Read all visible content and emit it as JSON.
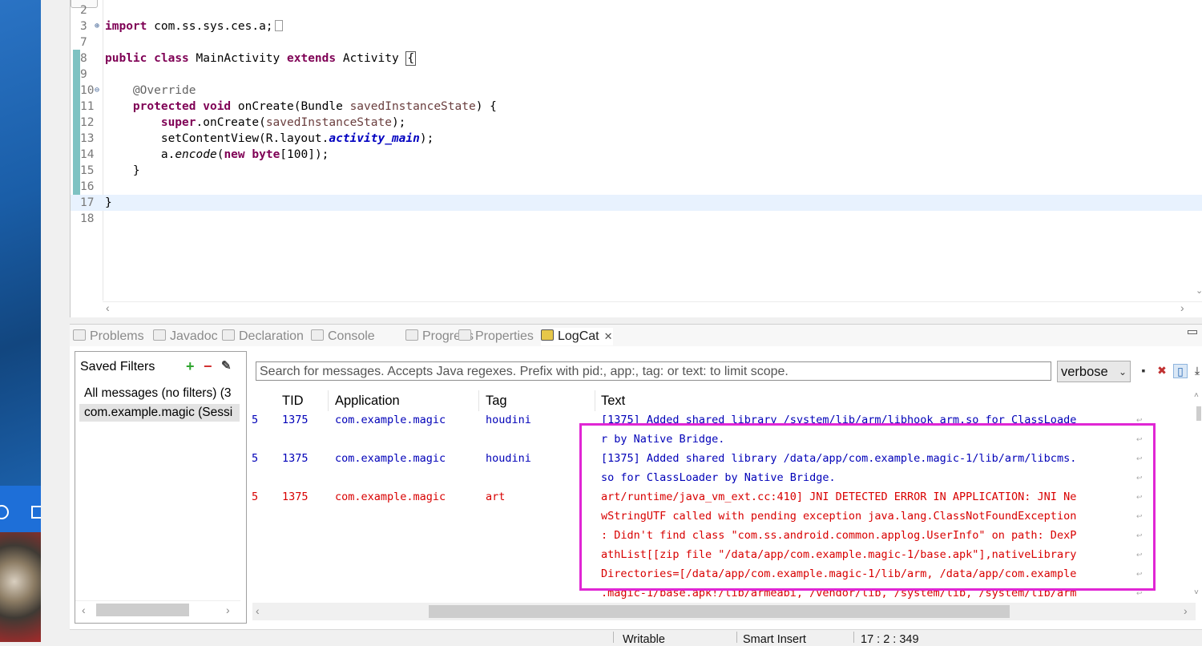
{
  "editor": {
    "lines": [
      {
        "num": "2",
        "tokens": []
      },
      {
        "num": "3",
        "tokens": [
          {
            "t": "import",
            "c": "kw"
          },
          {
            "t": " com.ss.sys.ces.a;",
            "c": ""
          }
        ],
        "fold": "⊕"
      },
      {
        "num": "7",
        "tokens": []
      },
      {
        "num": "8",
        "tokens": [
          {
            "t": "public",
            "c": "kw"
          },
          {
            "t": " ",
            "c": ""
          },
          {
            "t": "class",
            "c": "kw"
          },
          {
            "t": " MainActivity ",
            "c": ""
          },
          {
            "t": "extends",
            "c": "kw"
          },
          {
            "t": " Activity ",
            "c": ""
          },
          {
            "t": "{",
            "c": "bracket"
          }
        ]
      },
      {
        "num": "9",
        "tokens": []
      },
      {
        "num": "10",
        "tokens": [
          {
            "t": "    @Override",
            "c": "ann"
          }
        ],
        "fold": "⊖"
      },
      {
        "num": "11",
        "tokens": [
          {
            "t": "    ",
            "c": ""
          },
          {
            "t": "protected",
            "c": "kw"
          },
          {
            "t": " ",
            "c": ""
          },
          {
            "t": "void",
            "c": "kw"
          },
          {
            "t": " onCreate(Bundle ",
            "c": ""
          },
          {
            "t": "savedInstanceState",
            "c": "param"
          },
          {
            "t": ") {",
            "c": ""
          }
        ]
      },
      {
        "num": "12",
        "tokens": [
          {
            "t": "        ",
            "c": ""
          },
          {
            "t": "super",
            "c": "kw"
          },
          {
            "t": ".onCreate(",
            "c": ""
          },
          {
            "t": "savedInstanceState",
            "c": "param"
          },
          {
            "t": ");",
            "c": ""
          }
        ]
      },
      {
        "num": "13",
        "tokens": [
          {
            "t": "        setContentView(R.layout.",
            "c": ""
          },
          {
            "t": "activity_main",
            "c": "field"
          },
          {
            "t": ");",
            "c": ""
          }
        ]
      },
      {
        "num": "14",
        "tokens": [
          {
            "t": "        a.",
            "c": ""
          },
          {
            "t": "encode",
            "c": "it"
          },
          {
            "t": "(",
            "c": ""
          },
          {
            "t": "new",
            "c": "kw"
          },
          {
            "t": " ",
            "c": ""
          },
          {
            "t": "byte",
            "c": "kw"
          },
          {
            "t": "[100]);",
            "c": ""
          }
        ]
      },
      {
        "num": "15",
        "tokens": [
          {
            "t": "    }",
            "c": ""
          }
        ]
      },
      {
        "num": "16",
        "tokens": []
      },
      {
        "num": "17",
        "tokens": [
          {
            "t": "}",
            "c": ""
          }
        ],
        "current": true
      },
      {
        "num": "18",
        "tokens": []
      }
    ]
  },
  "panel": {
    "tabs": [
      {
        "label": "Problems",
        "name": "tab-problems",
        "icon": "problems-icon"
      },
      {
        "label": "Javadoc",
        "name": "tab-javadoc",
        "icon": "javadoc-icon"
      },
      {
        "label": "Declaration",
        "name": "tab-declaration",
        "icon": "declaration-icon"
      },
      {
        "label": "Console",
        "name": "tab-console",
        "icon": "console-icon"
      },
      {
        "label": "Progress",
        "name": "tab-progress",
        "icon": "progress-icon"
      },
      {
        "label": "Properties",
        "name": "tab-properties",
        "icon": "properties-icon"
      },
      {
        "label": "LogCat",
        "name": "tab-logcat",
        "icon": "logcat-icon",
        "active": true
      }
    ]
  },
  "filters": {
    "title": "Saved Filters",
    "items": [
      {
        "label": "All messages (no filters) (3",
        "selected": false
      },
      {
        "label": "com.example.magic (Sessi",
        "selected": true
      }
    ]
  },
  "search": {
    "placeholder": "Search for messages. Accepts Java regexes. Prefix with pid:, app:, tag: or text: to limit scope."
  },
  "level": {
    "selected": "verbose"
  },
  "table": {
    "headers": {
      "tid": "TID",
      "app": "Application",
      "tag": "Tag",
      "text": "Text"
    },
    "rows": [
      {
        "level": "5",
        "tid": "1375",
        "app": "com.example.magic",
        "tag": "houdini",
        "color": "blue",
        "text": [
          "[1375] Added shared library /system/lib/arm/libhook_arm.so for ClassLoade",
          "r by Native Bridge."
        ]
      },
      {
        "level": "5",
        "tid": "1375",
        "app": "com.example.magic",
        "tag": "houdini",
        "color": "blue",
        "text": [
          "[1375] Added shared library /data/app/com.example.magic-1/lib/arm/libcms.",
          "so for ClassLoader by Native Bridge."
        ]
      },
      {
        "level": "5",
        "tid": "1375",
        "app": "com.example.magic",
        "tag": "art",
        "color": "red",
        "text": [
          "art/runtime/java_vm_ext.cc:410] JNI DETECTED ERROR IN APPLICATION: JNI Ne",
          "wStringUTF called with pending exception java.lang.ClassNotFoundException",
          ": Didn't find class \"com.ss.android.common.applog.UserInfo\" on path: DexP",
          "athList[[zip file \"/data/app/com.example.magic-1/base.apk\"],nativeLibrary",
          "Directories=[/data/app/com.example.magic-1/lib/arm, /data/app/com.example",
          ".magic-1/base.apk!/lib/armeabi, /vendor/lib, /system/lib, /system/lib/arm"
        ]
      }
    ]
  },
  "status": {
    "writable": "Writable",
    "insert": "Smart Insert",
    "position": "17 : 2 : 349"
  },
  "colors": {
    "highlight": "#e026d4",
    "keyword": "#7f0055",
    "log_blue": "#0000b8",
    "log_red": "#d80000"
  }
}
